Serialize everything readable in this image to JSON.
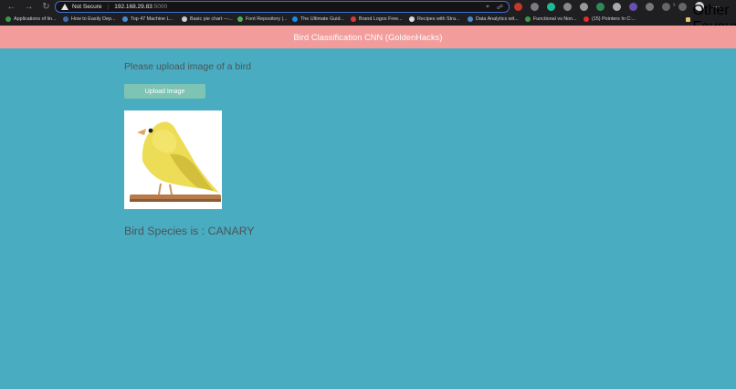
{
  "browser": {
    "security_label": "Not Secure",
    "url_host": "192.168.29.83",
    "url_port": ":5000",
    "bookmarks": [
      {
        "label": "Applications of lin...",
        "icon": "green-leaf-icon",
        "color": "#3a9a4a"
      },
      {
        "label": "How to Easily Dep...",
        "icon": "blue-circle-icon",
        "color": "#3b6ea8"
      },
      {
        "label": "Top 47 Machine L...",
        "icon": "blue-circle-icon",
        "color": "#4a8ad0"
      },
      {
        "label": "Basic pie chart —...",
        "icon": "gray-circle-icon",
        "color": "#cccccc"
      },
      {
        "label": "Font Repository |...",
        "icon": "green-circle-icon",
        "color": "#4caf50"
      },
      {
        "label": "The Ultimate Guid...",
        "icon": "blue-square-icon",
        "color": "#1e88e5"
      },
      {
        "label": "Brand Logos Free...",
        "icon": "red-circle-icon",
        "color": "#d83a3a"
      },
      {
        "label": "Recipes with Stra...",
        "icon": "frame-icon",
        "color": "#dddddd"
      },
      {
        "label": "Data Analytics wit...",
        "icon": "bar-chart-icon",
        "color": "#4a8ad0"
      },
      {
        "label": "Functional vs Non...",
        "icon": "green-dash-icon",
        "color": "#3a9a4a"
      },
      {
        "label": "(15) Pointers In C:...",
        "icon": "youtube-icon",
        "color": "#e52d27"
      }
    ],
    "other_bookmarks": "Other Favourites"
  },
  "app": {
    "title": "Bird Classification CNN (GoldenHacks)",
    "prompt": "Please upload image of a bird",
    "upload_label": "Upload Image",
    "result_text": "Bird Species is : CANARY"
  },
  "colors": {
    "header": "#f29d9c",
    "background": "#49acc0",
    "button": "#7ec4b4",
    "text": "#4a555b"
  }
}
